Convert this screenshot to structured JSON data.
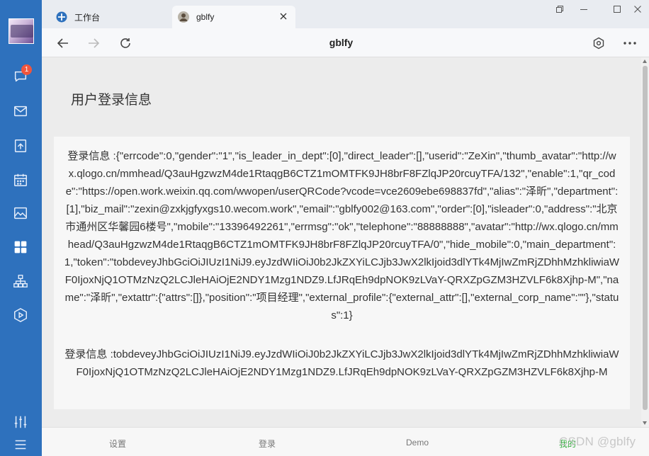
{
  "sidebar": {
    "avatar": "user-avatar",
    "message_badge": "1",
    "items": [
      {
        "icon": "chat-icon"
      },
      {
        "icon": "mail-icon"
      },
      {
        "icon": "document-icon"
      },
      {
        "icon": "calendar-icon"
      },
      {
        "icon": "image-icon"
      },
      {
        "icon": "apps-grid-icon"
      },
      {
        "icon": "org-chart-icon"
      },
      {
        "icon": "play-hexagon-icon"
      }
    ],
    "bottom_items": [
      {
        "icon": "sliders-icon"
      },
      {
        "icon": "menu-icon"
      }
    ],
    "color": "#2e71bd"
  },
  "tabs": [
    {
      "label": "工作台",
      "icon": "workbench-icon"
    },
    {
      "label": "gblfy",
      "icon": "profile-photo-icon",
      "active": true
    }
  ],
  "window_controls": [
    "restore-icon",
    "minimize-icon",
    "maximize-icon",
    "close-icon"
  ],
  "navbar": {
    "title": "gblfy"
  },
  "content": {
    "heading": "用户登录信息",
    "info_text": "登录信息 :{\"errcode\":0,\"gender\":\"1\",\"is_leader_in_dept\":[0],\"direct_leader\":[],\"userid\":\"ZeXin\",\"thumb_avatar\":\"http://wx.qlogo.cn/mmhead/Q3auHgzwzM4de1RtaqgB6CTZ1mOMTFK9JH8brF8FZlqJP20rcuyTFA/132\",\"enable\":1,\"qr_code\":\"https://open.work.weixin.qq.com/wwopen/userQRCode?vcode=vce2609ebe698837fd\",\"alias\":\"泽昕\",\"department\":[1],\"biz_mail\":\"zexin@zxkjgfyxgs10.wecom.work\",\"email\":\"gblfy002@163.com\",\"order\":[0],\"isleader\":0,\"address\":\"北京市通州区华馨园6楼号\",\"mobile\":\"13396492261\",\"errmsg\":\"ok\",\"telephone\":\"88888888\",\"avatar\":\"http://wx.qlogo.cn/mmhead/Q3auHgzwzM4de1RtaqgB6CTZ1mOMTFK9JH8brF8FZlqJP20rcuyTFA/0\",\"hide_mobile\":0,\"main_department\":1,\"token\":\"tobdeveyJhbGciOiJIUzI1NiJ9.eyJzdWIiOiJ0b2JkZXYiLCJjb3JwX2lkIjoid3dlYTk4MjIwZmRjZDhhMzhkliwiaWF0IjoxNjQ1OTMzNzQ2LCJleHAiOjE2NDY1Mzg1NDZ9.LfJRqEh9dpNOK9zLVaY-QRXZpGZM3HZVLF6k8Xjhp-M\",\"name\":\"泽昕\",\"extattr\":{\"attrs\":[]},\"position\":\"项目经理\",\"external_profile\":{\"external_attr\":[],\"external_corp_name\":\"\"},\"status\":1}",
    "token_text": "登录信息 :tobdeveyJhbGciOiJIUzI1NiJ9.eyJzdWIiOiJ0b2JkZXYiLCJjb3JwX2lkIjoid3dlYTk4MjIwZmRjZDhhMzhkliwiaWF0IjoxNjQ1OTMzNzQ2LCJleHAiOjE2NDY1Mzg1NDZ9.LfJRqEh9dpNOK9zLVaY-QRXZpGZM3HZVLF6k8Xjhp-M"
  },
  "bottom_tabs": [
    {
      "label": "设置"
    },
    {
      "label": "登录"
    },
    {
      "label": "Demo"
    },
    {
      "label": "我的",
      "active": true
    }
  ],
  "watermark": "CSDN @gblfy",
  "accent_color": "#2faa3a"
}
